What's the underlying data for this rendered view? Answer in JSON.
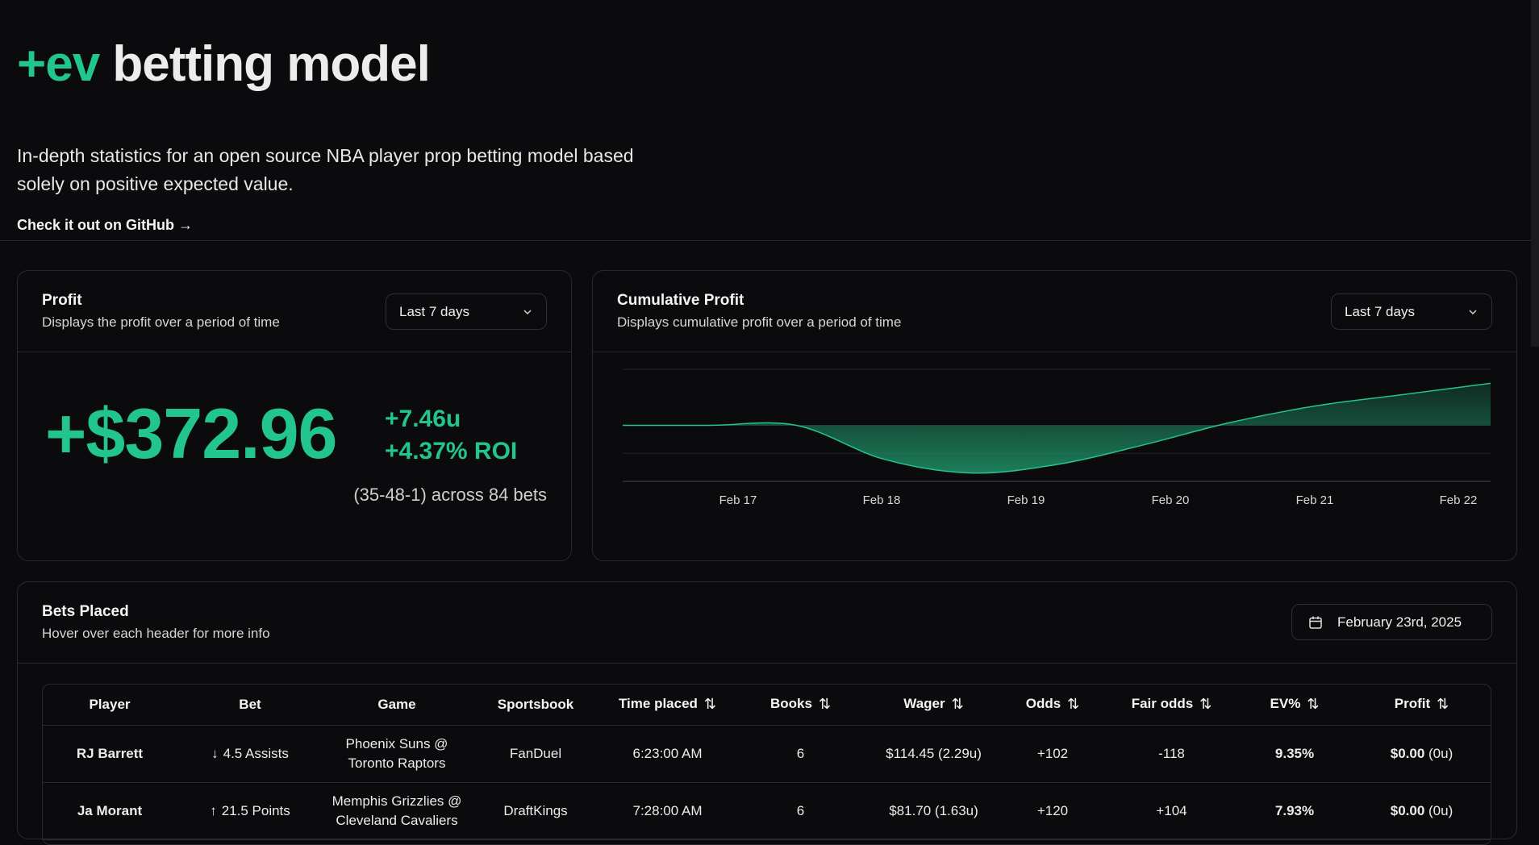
{
  "hero": {
    "title_accent": "+ev",
    "title_rest": "betting model",
    "description": "In-depth statistics for an open source NBA player prop betting model based solely on positive expected value.",
    "github_link": "Check it out on GitHub →"
  },
  "profit_card": {
    "title": "Profit",
    "subtitle": "Displays the profit over a period of time",
    "range": "Last 7 days",
    "amount": "+$372.96",
    "units": "+7.46u",
    "roi": "+4.37% ROI",
    "record": "(35-48-1) across 84 bets"
  },
  "cumulative_card": {
    "title": "Cumulative Profit",
    "subtitle": "Displays cumulative profit over a period of time",
    "range": "Last 7 days"
  },
  "chart_data": {
    "type": "area",
    "title": "Cumulative Profit",
    "x": [
      "Feb 16",
      "Feb 17",
      "Feb 18",
      "Feb 18.5",
      "Feb 19",
      "Feb 19.5",
      "Feb 20",
      "Feb 20.5",
      "Feb 21",
      "Feb 21.5",
      "Feb 22"
    ],
    "tick_labels": [
      "Feb 17",
      "Feb 18",
      "Feb 19",
      "Feb 20",
      "Feb 21",
      "Feb 22"
    ],
    "values": [
      0,
      0,
      0,
      -0.6,
      -0.85,
      -0.7,
      -0.35,
      0.05,
      0.35,
      0.55,
      0.75
    ],
    "ylim": [
      -1.0,
      1.0
    ],
    "grid": true,
    "colors": {
      "line": "#22c58b",
      "fill": "#1e8a62"
    }
  },
  "bets_card": {
    "title": "Bets Placed",
    "subtitle": "Hover over each header for more info",
    "date": "February 23rd, 2025",
    "columns": [
      "Player",
      "Bet",
      "Game",
      "Sportsbook",
      "Time placed",
      "Books",
      "Wager",
      "Odds",
      "Fair odds",
      "EV%",
      "Profit"
    ],
    "rows": [
      {
        "player": "RJ Barrett",
        "bet_dir": "↓",
        "bet": "4.5 Assists",
        "game_line1": "Phoenix Suns @",
        "game_line2": "Toronto Raptors",
        "sportsbook": "FanDuel",
        "time": "6:23:00 AM",
        "books": "6",
        "wager": "$114.45 (2.29u)",
        "odds": "+102",
        "fair_odds": "-118",
        "ev": "9.35%",
        "profit": "$0.00",
        "profit_units": "(0u)"
      },
      {
        "player": "Ja Morant",
        "bet_dir": "↑",
        "bet": "21.5 Points",
        "game_line1": "Memphis Grizzlies @",
        "game_line2": "Cleveland Cavaliers",
        "sportsbook": "DraftKings",
        "time": "7:28:00 AM",
        "books": "6",
        "wager": "$81.70 (1.63u)",
        "odds": "+120",
        "fair_odds": "+104",
        "ev": "7.93%",
        "profit": "$0.00",
        "profit_units": "(0u)"
      }
    ]
  },
  "icons": {
    "chevron": "chevron-down-icon",
    "calendar": "calendar-icon",
    "sort": "sort-icon"
  },
  "colors": {
    "accent": "#22c58b",
    "background": "#0b0b0d",
    "border": "#2a2a2e"
  }
}
